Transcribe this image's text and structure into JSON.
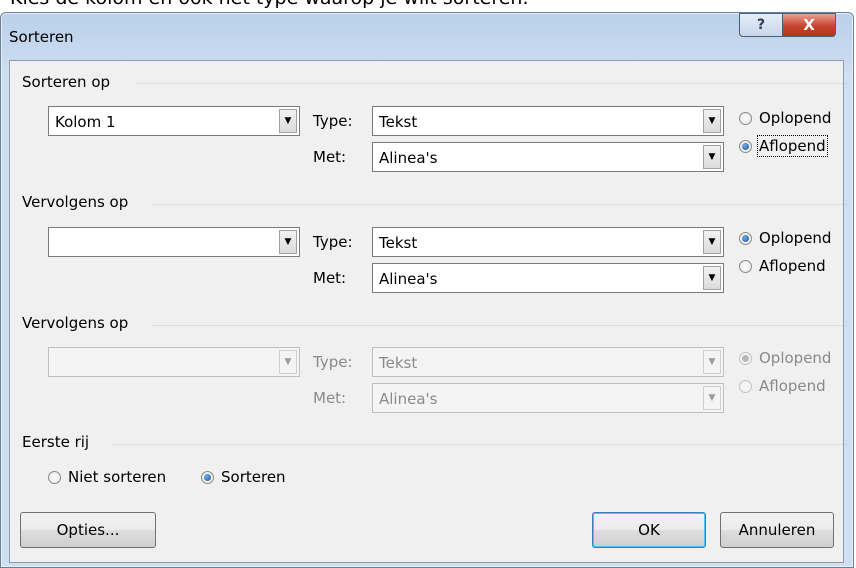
{
  "top_caption": "Kies de kolom en ook het type waarop je wilt sorteren.",
  "dialog": {
    "title": "Sorteren",
    "help_symbol": "?",
    "close_symbol": "X"
  },
  "sort_by": {
    "label": "Sorteren op",
    "column_value": "Kolom 1",
    "type_label": "Type:",
    "type_value": "Tekst",
    "using_label": "Met:",
    "using_value": "Alinea's",
    "ascending_label": "Oplopend",
    "descending_label": "Aflopend",
    "selected": "descending"
  },
  "then_by_1": {
    "label": "Vervolgens op",
    "column_value": "",
    "type_label": "Type:",
    "type_value": "Tekst",
    "using_label": "Met:",
    "using_value": "Alinea's",
    "ascending_label": "Oplopend",
    "descending_label": "Aflopend",
    "selected": "ascending"
  },
  "then_by_2": {
    "label": "Vervolgens op",
    "column_value": "",
    "type_label": "Type:",
    "type_value": "Tekst",
    "using_label": "Met:",
    "using_value": "Alinea's",
    "ascending_label": "Oplopend",
    "descending_label": "Aflopend",
    "selected": "ascending",
    "disabled": true
  },
  "header_row": {
    "label": "Eerste rij",
    "no_sort_label": "Niet sorteren",
    "sort_label": "Sorteren",
    "selected": "sort"
  },
  "buttons": {
    "options": "Opties...",
    "ok": "OK",
    "cancel": "Annuleren"
  },
  "icons": {
    "dropdown": "chevron-down-icon",
    "help": "help-icon",
    "close": "close-icon"
  }
}
